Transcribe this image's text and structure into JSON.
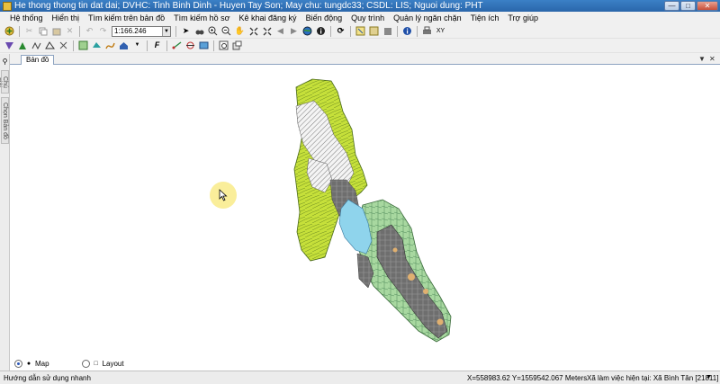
{
  "window": {
    "title": "He thong thong tin dat dai; DVHC: Tinh Binh Dinh - Huyen Tay Son; May chu: tungdc33; CSDL: LIS; Nguoi dung: PHT",
    "controls": [
      "minimize-icon",
      "maximize-icon",
      "close-icon"
    ]
  },
  "menu": [
    "Hệ thống",
    "Hiển thị",
    "Tìm kiếm trên bản đồ",
    "Tìm kiếm hồ sơ",
    "Kê khai đăng ký",
    "Biến động",
    "Quy trình",
    "Quản lý ngăn chặn",
    "Tiện ích",
    "Trợ giúp"
  ],
  "toolbar": {
    "scale_value": "1:166.246"
  },
  "side_panels": [
    "Chú giải",
    "Chọn Bản đồ"
  ],
  "tabs": {
    "active": "Bản đồ"
  },
  "view_switch": {
    "map_label": "Map",
    "layout_label": "Layout",
    "selected": "Map"
  },
  "status": {
    "help": "Hướng dẫn sử dụng nhanh",
    "coordinates": "X=558983.62 Y=1559542.067 Meters",
    "workspace": "Xã làm việc hiện tại: Xã Bình Tân [21811]"
  },
  "map_colors": {
    "yellow_green": "#c6e03a",
    "light_green": "#a8d8a0",
    "gray_parcels": "#6e6e6e",
    "hatched": "#d8d8d8",
    "water": "#8fd4ec",
    "orange": "#e0b070"
  }
}
